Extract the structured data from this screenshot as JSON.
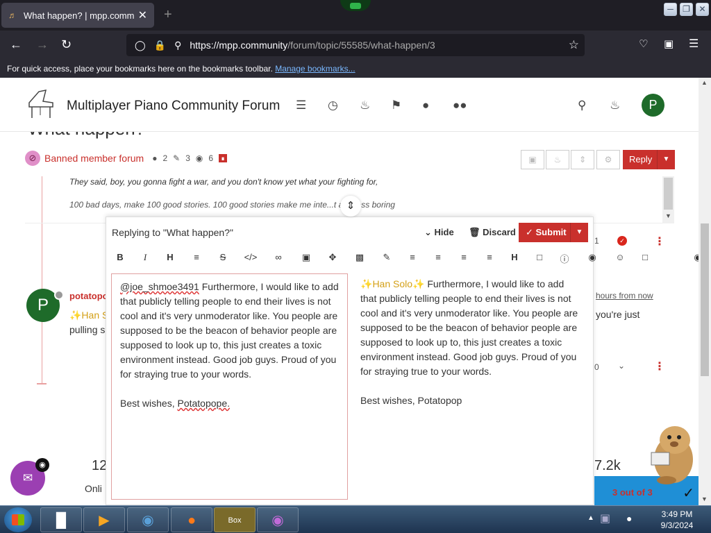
{
  "browser": {
    "tab_title": "What happen? | mpp.community",
    "url_domain": "https://mpp.community",
    "url_path": "/forum/topic/55585/what-happen/3",
    "bookmarks_message": "For quick access, place your bookmarks here on the bookmarks toolbar.",
    "bookmarks_link": "Manage bookmarks..."
  },
  "site": {
    "title": "Multiplayer Piano Community Forum",
    "avatar_letter": "P"
  },
  "topic": {
    "title": "What happen?",
    "category": "Banned member forum",
    "posters": "2",
    "posts": "3",
    "views": "6",
    "reply_label": "Reply"
  },
  "quote": {
    "line1": "They said, boy, you gonna fight a war, and you don't know yet what your fighting for,",
    "line2": "100 bad days, make 100 good stories. 100 good stories make me inte...t and less boring"
  },
  "post": {
    "avatar_letter": "P",
    "author": "potatopo",
    "snippet_1": "✨Han S",
    "snippet_2": "pulling s",
    "time": "hours from now",
    "right_text": "you're just",
    "vote_count": "0",
    "badge_count": "1"
  },
  "composer": {
    "title": "Replying to \"What happen?\"",
    "hide_label": "Hide",
    "discard_label": "Discard",
    "submit_label": "Submit",
    "editor_mention": "@joe_shmoe3491",
    "editor_body": "Furthermore, I would like to add that publicly telling people to end their lives is not cool and it's very unmoderator like. You people are supposed to be the beacon of behavior people are supposed to look up to, this just creates a toxic environment instead. Good job guys. Proud of you for straying true to your words.",
    "editor_sign_a": "Best wishes,",
    "editor_sign_b": "Potatopope.",
    "preview_name": "Han Solo",
    "preview_body": "Furthermore, I would like to add that publicly telling people to end their lives is not cool and it's very unmoderator like. You people are supposed to be the beacon of behavior people are supposed to look up to, this just creates a toxic environment instead. Good job guys. Proud of you for straying true to your words.",
    "preview_sign": "Best wishes, Potatopop"
  },
  "stats": {
    "left_number": "12",
    "left_label": "Onli",
    "right_number": "7.2k"
  },
  "overlay": {
    "progress_text": "3 out of 3"
  },
  "taskbar": {
    "time": "3:49 PM",
    "date": "9/3/2024",
    "game_label": "Box"
  }
}
